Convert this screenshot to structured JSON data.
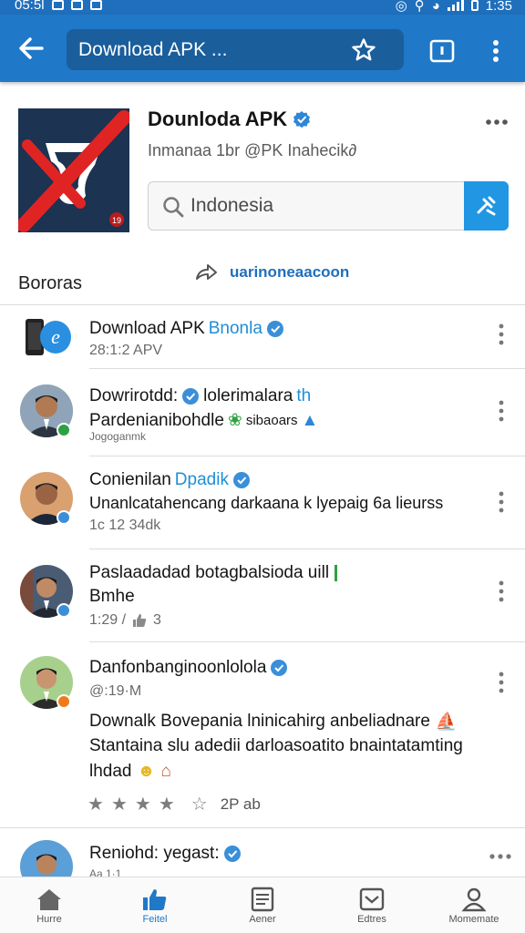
{
  "status_bar": {
    "time_left": "05:5l",
    "time_right": "1:35"
  },
  "browser": {
    "url_text": "Download APK ...",
    "icons": {
      "back": "arrow-left-icon",
      "bookmark": "star-icon",
      "tabs": "tab-switcher-icon",
      "menu": "kebab-menu-icon"
    }
  },
  "app": {
    "title": "Dounloda APK",
    "subtitle": "Inmanaa 1br @PK Inahecik∂",
    "icon_badge": "19",
    "search_value": "Indonesia",
    "section_label": "Bororas",
    "promo_text": "uarinoneaacoon"
  },
  "feed": [
    {
      "title": "Download APK",
      "title_accent": "Bnonla",
      "meta": "28:1:2 APV"
    },
    {
      "title": "Dowrirotdd:",
      "title_rest": "lolerimalara",
      "title_accent": "th",
      "line1": "Pardenianibohdle",
      "line1_rest": "sibaoars",
      "meta": "Jogoganmk"
    },
    {
      "title": "Conienilan",
      "title_accent": "Dpadik",
      "line1": "Unanlcatahencang darkaana k lyepaig 6a lieurss",
      "meta": "1c 12 34dk"
    },
    {
      "title": "Paslaadadad botagbalsioda uill",
      "line1": "Bmhe",
      "meta": "1:29 /",
      "meta_count": "3"
    },
    {
      "title": "Danfonbanginoonlolola",
      "meta": "@:19·M",
      "body1": "Downalk Bovepania lninicahirg anbeliadnare",
      "body2": "Stantaina slu adedii darloasoatito bnaintatamting",
      "body3": "lhdad",
      "rating_text": "2P  ab"
    },
    {
      "title": "Reniohd: yegast:",
      "meta": "Aa 1·1"
    }
  ],
  "bottom_nav": [
    {
      "label": "Hurre",
      "icon": "home-icon"
    },
    {
      "label": "Feitel",
      "icon": "thumbs-up-icon"
    },
    {
      "label": "Aener",
      "icon": "document-icon"
    },
    {
      "label": "Edtres",
      "icon": "inbox-icon"
    },
    {
      "label": "Momemate",
      "icon": "person-icon"
    }
  ],
  "colors": {
    "appbar": "#1f78c8",
    "accent": "#1e8ed6",
    "search_button": "#2196e3",
    "app_icon_bg": "#1c3352",
    "slash_red": "#e02424"
  }
}
